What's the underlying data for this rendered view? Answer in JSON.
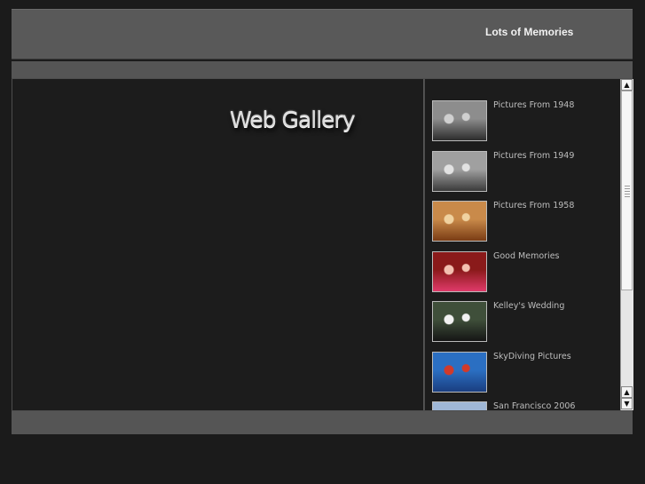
{
  "header": {
    "site_title": "Lots of Memories"
  },
  "main": {
    "logo_text": "Web Gallery"
  },
  "gallery": {
    "items": [
      {
        "label": "Pictures From 1948",
        "thumb_icon": "bw-group-photo-icon",
        "colors": [
          "#8d8d8d",
          "#2c2c2c",
          "#d0d0d0"
        ]
      },
      {
        "label": "Pictures From 1949",
        "thumb_icon": "bw-doorway-photo-icon",
        "colors": [
          "#a0a0a0",
          "#3a3a3a",
          "#e2e2e2"
        ]
      },
      {
        "label": "Pictures From 1958",
        "thumb_icon": "sepia-room-photo-icon",
        "colors": [
          "#c98a4a",
          "#7a3c14",
          "#f0d2a0"
        ]
      },
      {
        "label": "Good Memories",
        "thumb_icon": "red-portrait-photo-icon",
        "colors": [
          "#8a1a1a",
          "#e03a6a",
          "#f3c0b0"
        ]
      },
      {
        "label": "Kelley's Wedding",
        "thumb_icon": "wedding-couple-photo-icon",
        "colors": [
          "#3f4f3a",
          "#151515",
          "#f2f2f2"
        ]
      },
      {
        "label": "SkyDiving Pictures",
        "thumb_icon": "sky-diver-photo-icon",
        "colors": [
          "#2b6fc2",
          "#1a3e80",
          "#d23a2a"
        ]
      },
      {
        "label": "San Francisco 2006",
        "thumb_icon": "city-sky-photo-icon",
        "colors": [
          "#9fb7d6",
          "#c8d5e6",
          "#6e86a8"
        ]
      }
    ]
  },
  "scrollbar": {
    "up_icon": "scroll-up-arrow-icon",
    "down_icon": "scroll-down-arrow-icon"
  }
}
